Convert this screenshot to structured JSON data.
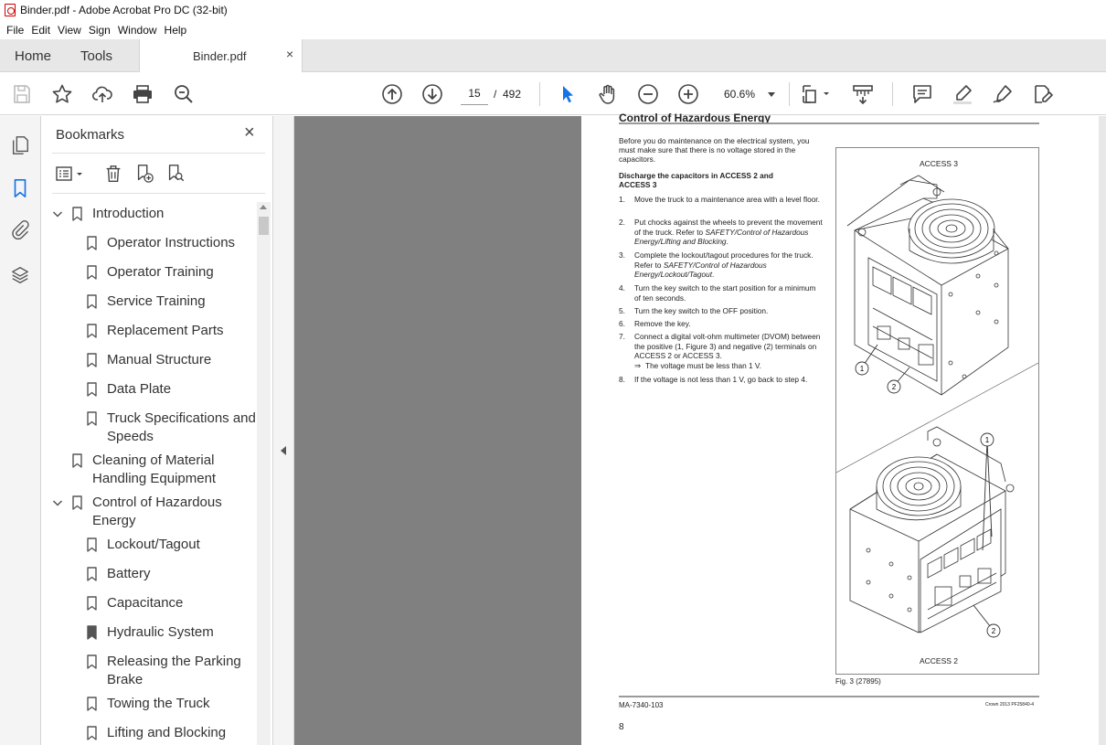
{
  "window": {
    "title": "Binder.pdf - Adobe Acrobat Pro DC (32-bit)"
  },
  "menu": [
    "File",
    "Edit",
    "View",
    "Sign",
    "Window",
    "Help"
  ],
  "tabs": {
    "home": "Home",
    "tools": "Tools",
    "document": "Binder.pdf",
    "close": "×"
  },
  "toolbar": {
    "current_page": "15",
    "page_separator": "/",
    "total_pages": "492",
    "zoom": "60.6%"
  },
  "bookmarks": {
    "title": "Bookmarks",
    "close": "×",
    "items": [
      {
        "label": "Introduction",
        "level": 0,
        "expanded": true
      },
      {
        "label": "Operator Instructions",
        "level": 1
      },
      {
        "label": "Operator Training",
        "level": 1
      },
      {
        "label": "Service Training",
        "level": 1
      },
      {
        "label": "Replacement Parts",
        "level": 1
      },
      {
        "label": "Manual Structure",
        "level": 1
      },
      {
        "label": "Data Plate",
        "level": 1
      },
      {
        "label": "Truck Specifications and Speeds",
        "level": 1
      },
      {
        "label": "Cleaning of Material Handling Equipment",
        "level": 0
      },
      {
        "label": "Control of Hazardous Energy",
        "level": 0,
        "expanded": true
      },
      {
        "label": "Lockout/Tagout",
        "level": 1
      },
      {
        "label": "Battery",
        "level": 1
      },
      {
        "label": "Capacitance",
        "level": 1
      },
      {
        "label": "Hydraulic System",
        "level": 1
      },
      {
        "label": "Releasing the Parking Brake",
        "level": 1
      },
      {
        "label": "Towing the Truck",
        "level": 1
      },
      {
        "label": "Lifting and Blocking",
        "level": 1
      }
    ]
  },
  "page": {
    "heading": "Control of Hazardous Energy",
    "intro": "Before you do maintenance on the electrical system, you must make sure that there is no voltage stored in the capacitors.",
    "subheading": "Discharge the capacitors in ACCESS 2 and ACCESS 3",
    "steps": [
      {
        "num": "1.",
        "text": "Move the truck to a maintenance area with a level floor."
      },
      {
        "num": "2.",
        "text": "Put chocks against the wheels to prevent the movement of the truck. Refer to ",
        "italic": "SAFETY/Control of Hazardous Energy/Lifting and Blocking",
        "after": "."
      },
      {
        "num": "3.",
        "text": "Complete the lockout/tagout procedures for the truck. Refer to ",
        "italic": "SAFETY/Control of Hazardous Energy/Lockout/Tagout",
        "after": "."
      },
      {
        "num": "4.",
        "text": "Turn the key switch to the start position for a minimum of ten seconds."
      },
      {
        "num": "5.",
        "text": "Turn the key switch to the OFF position."
      },
      {
        "num": "6.",
        "text": "Remove the key."
      },
      {
        "num": "7.",
        "text": "Connect a digital volt-ohm multimeter (DVOM) between the positive (1, Figure 3) and negative (2) terminals on ACCESS 2 or ACCESS 3."
      },
      {
        "num": "⇒",
        "text": "The voltage must be less than 1 V."
      },
      {
        "num": "8.",
        "text": "If the voltage is not less than 1 V, go back to step 4."
      }
    ],
    "figure": {
      "top_label": "ACCESS 3",
      "bottom_label": "ACCESS 2",
      "callouts": [
        "1",
        "2",
        "1",
        "2"
      ],
      "caption": "Fig. 3 (27895)"
    },
    "footer_left": "MA-7340-103",
    "footer_right": "Crown 2013 PF25840-4",
    "page_number": "8"
  }
}
